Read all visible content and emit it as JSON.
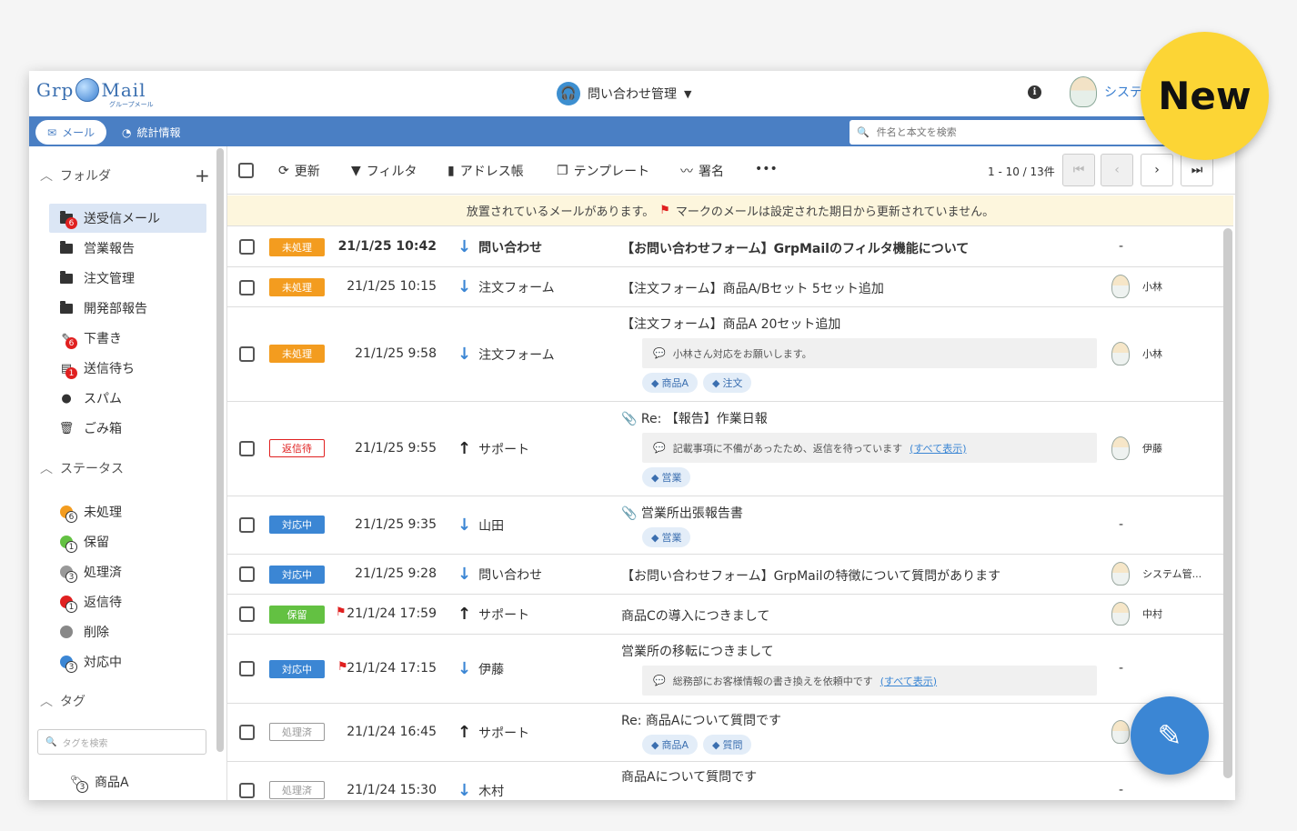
{
  "header": {
    "logo_text_left": "Grp",
    "logo_text_right": "Mail",
    "logo_sub": "グループメール",
    "app_title": "問い合わせ管理",
    "user_name": "システ"
  },
  "navbar": {
    "mail_tab": "メール",
    "stats_tab": "統計情報",
    "search_placeholder": "件名と本文を検索"
  },
  "sidebar": {
    "folders_title": "フォルダ",
    "folders": [
      {
        "label": "送受信メール",
        "badge": "6",
        "icon": "folder-icon"
      },
      {
        "label": "営業報告",
        "icon": "folder-icon"
      },
      {
        "label": "注文管理",
        "icon": "folder-icon"
      },
      {
        "label": "開発部報告",
        "icon": "folder-icon"
      },
      {
        "label": "下書き",
        "badge": "6",
        "icon": "pencil-icon"
      },
      {
        "label": "送信待ち",
        "badge": "1",
        "icon": "outbox-icon"
      },
      {
        "label": "スパム",
        "icon": "bomb-icon"
      },
      {
        "label": "ごみ箱",
        "icon": "trash-icon"
      }
    ],
    "status_title": "ステータス",
    "statuses": [
      {
        "label": "未処理",
        "count": "6",
        "color": "#f39c1f"
      },
      {
        "label": "保留",
        "count": "1",
        "color": "#63c142"
      },
      {
        "label": "処理済",
        "count": "3",
        "color": "#999999"
      },
      {
        "label": "返信待",
        "count": "1",
        "color": "#e02020"
      },
      {
        "label": "削除",
        "color": "#888888"
      },
      {
        "label": "対応中",
        "count": "3",
        "color": "#3b86d4"
      }
    ],
    "tags_title": "タグ",
    "tag_search_placeholder": "タグを検索",
    "tags": [
      {
        "label": "商品A",
        "count": "3"
      }
    ]
  },
  "toolbar": {
    "refresh": "更新",
    "filter": "フィルタ",
    "address_book": "アドレス帳",
    "template": "テンプレート",
    "signature": "署名",
    "more": "•••",
    "pager": "1 - 10 / 13件"
  },
  "notice": {
    "text_before": "放置されているメールがあります。",
    "text_after": "マークのメールは設定された期日から更新されていません。"
  },
  "emails": [
    {
      "status": "未処理",
      "date": "21/1/25 10:42",
      "dir": "down",
      "from": "問い合わせ",
      "subject": "【お問い合わせフォーム】GrpMailのフィルタ機能について",
      "assignee": "-",
      "bold": true
    },
    {
      "status": "未処理",
      "date": "21/1/25 10:15",
      "dir": "down",
      "from": "注文フォーム",
      "subject": "【注文フォーム】商品A/Bセット 5セット追加",
      "assignee": "小林"
    },
    {
      "status": "未処理",
      "date": "21/1/25 9:58",
      "dir": "down",
      "from": "注文フォーム",
      "subject": "【注文フォーム】商品A 20セット追加",
      "comment": "小林さん対応をお願いします。",
      "tags": [
        "商品A",
        "注文"
      ],
      "assignee": "小林"
    },
    {
      "status": "返信待",
      "date": "21/1/25 9:55",
      "dir": "up",
      "from": "サポート",
      "subject": "Re: 【報告】作業日報",
      "comment": "記載事項に不備があったため、返信を待っています",
      "comment_link": "(すべて表示)",
      "tags": [
        "営業"
      ],
      "assignee": "伊藤"
    },
    {
      "status": "対応中",
      "date": "21/1/25 9:35",
      "dir": "down",
      "from": "山田",
      "subject": "営業所出張報告書",
      "tags": [
        "営業"
      ],
      "assignee": "-"
    },
    {
      "status": "対応中",
      "date": "21/1/25 9:28",
      "dir": "down",
      "from": "問い合わせ",
      "subject": "【お問い合わせフォーム】GrpMailの特徴について質問があります",
      "assignee": "システム管..."
    },
    {
      "status": "保留",
      "date": "21/1/24 17:59",
      "dir": "up",
      "from": "サポート",
      "subject": "商品Cの導入につきまして",
      "assignee": "中村"
    },
    {
      "status": "対応中",
      "date": "21/1/24 17:15",
      "dir": "down",
      "from": "伊藤",
      "subject": "営業所の移転につきまして",
      "comment": "総務部にお客様情報の書き換えを依頼中です",
      "comment_link": "(すべて表示)",
      "assignee": "-"
    },
    {
      "status": "処理済",
      "date": "21/1/24 16:45",
      "dir": "up",
      "from": "サポート",
      "subject": "Re: 商品Aについて質問です",
      "tags": [
        "商品A",
        "質問"
      ]
    },
    {
      "status": "処理済",
      "date": "21/1/24 15:30",
      "dir": "down",
      "from": "木村",
      "subject": "商品Aについて質問です",
      "assignee": "-"
    }
  ],
  "new_badge": "New"
}
